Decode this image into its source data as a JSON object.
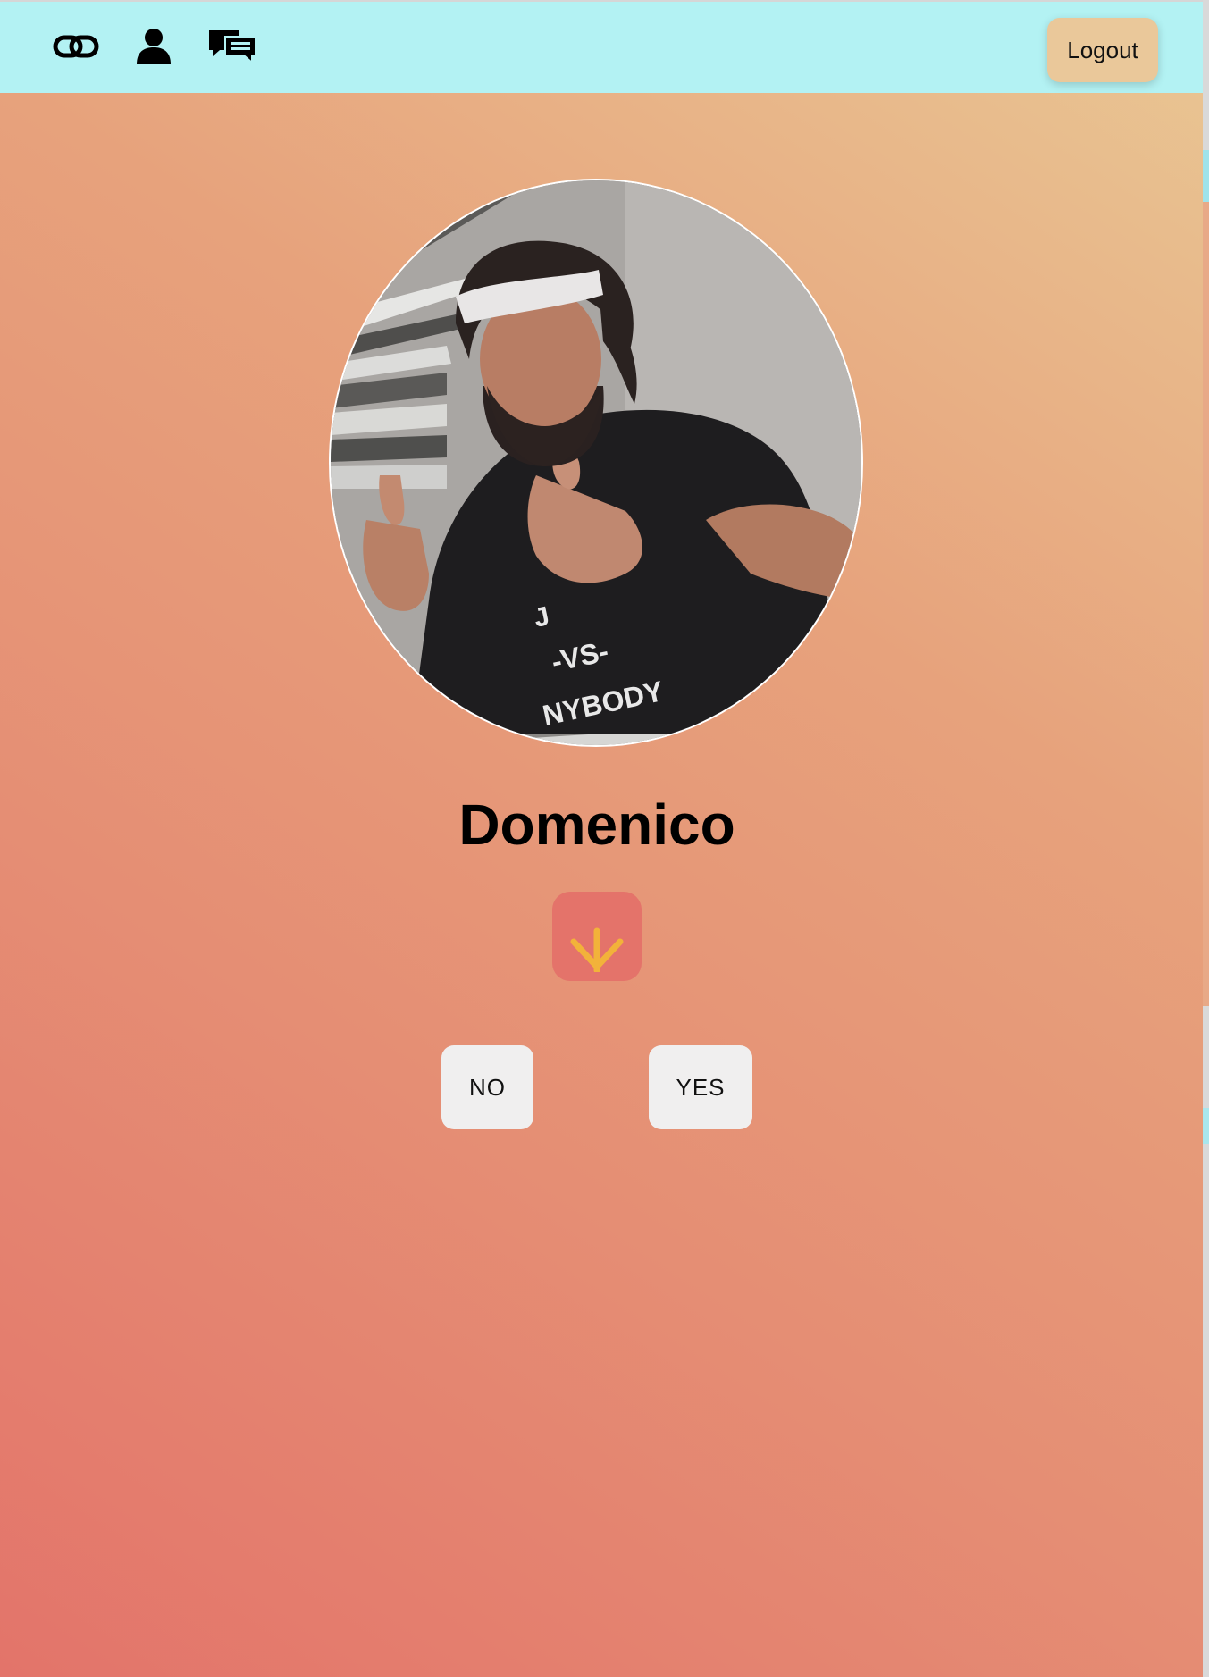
{
  "navbar": {
    "icons": [
      {
        "name": "link-icon"
      },
      {
        "name": "user-icon"
      },
      {
        "name": "chat-icon"
      }
    ],
    "logout_label": "Logout"
  },
  "profile": {
    "name": "Domenico",
    "photo_alt": "profile-photo",
    "shirt_text": "J… -VS- …NYBODY"
  },
  "actions": {
    "down_icon": "arrow-down-icon",
    "no_label": "NO",
    "yes_label": "YES"
  },
  "colors": {
    "navbar_bg": "#b3f2f3",
    "logout_bg": "#eac89a",
    "down_button_bg": "#e4736a",
    "arrow_color": "#f2b23a",
    "choice_button_bg": "#f0efef",
    "gradient_start": "#e3746a",
    "gradient_end": "#e9c794"
  }
}
